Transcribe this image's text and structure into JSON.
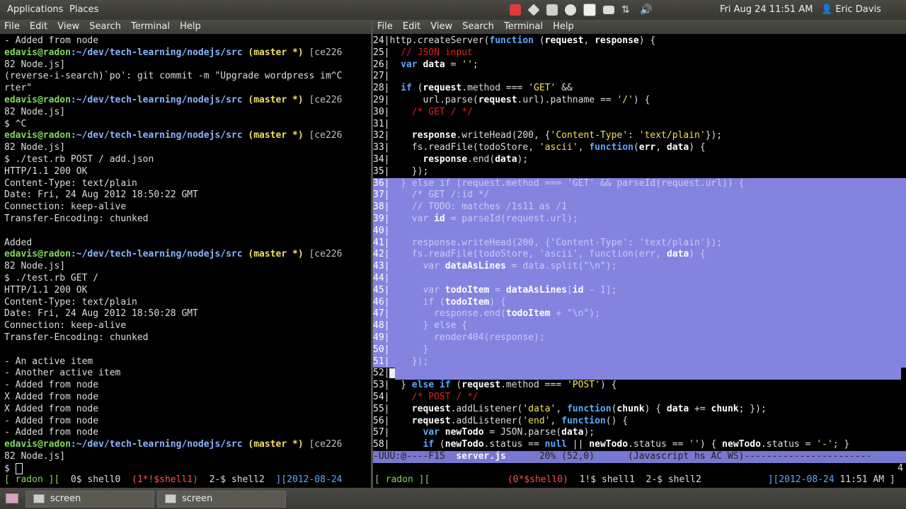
{
  "top_panel": {
    "applications": "Applications",
    "places": "Places",
    "clock": "Fri Aug 24 11:51 AM",
    "user": "Eric Davis",
    "icons": [
      "mail-icon",
      "dropbox-icon",
      "briefcase-icon",
      "chrome-icon",
      "newspaper-icon",
      "envelope-icon",
      "network-arrows-icon",
      "volume-icon"
    ]
  },
  "terminal_menu": [
    "File",
    "Edit",
    "View",
    "Search",
    "Terminal",
    "Help"
  ],
  "left_terminal": {
    "lines": [
      "- Added from node",
      "#P",
      "82 Node.js]",
      "(reverse-i-search)`po': git commit -m \"Upgrade wordpress im^C",
      "rter\"",
      "#P",
      "82 Node.js]",
      "$ ^C",
      "#P",
      "82 Node.js]",
      "$ ./test.rb POST / add.json",
      "HTTP/1.1 200 OK",
      "Content-Type: text/plain",
      "Date: Fri, 24 Aug 2012 18:50:22 GMT",
      "Connection: keep-alive",
      "Transfer-Encoding: chunked",
      "",
      "Added",
      "#P",
      "82 Node.js]",
      "$ ./test.rb GET /",
      "HTTP/1.1 200 OK",
      "Content-Type: text/plain",
      "Date: Fri, 24 Aug 2012 18:50:28 GMT",
      "Connection: keep-alive",
      "Transfer-Encoding: chunked",
      "",
      "- An active item",
      "- Another active item",
      "- Added from node",
      "X Added from node",
      "X Added from node",
      "- Added from node",
      "- Added from node",
      "#P",
      "82 Node.js]",
      "#C"
    ],
    "prompt": {
      "user": "edavis@radon",
      "path": ":~/dev/tech-learning/nodejs/src",
      "branch": " (master *)",
      "hash": " [ce226"
    },
    "current_prompt": "$ ",
    "screen_bar": {
      "host": "[ radon ][",
      "w0": "0$ shell0",
      "w1": "(1*!$shell1)",
      "w2": "2-$ shell2",
      "date": "][2012-08-24"
    }
  },
  "right_terminal": {
    "code": [
      {
        "n": "24",
        "t": "http.createServer(function (request, response) {"
      },
      {
        "n": "25",
        "t": "  // JSON input"
      },
      {
        "n": "26",
        "t": "  var data = '';"
      },
      {
        "n": "27",
        "t": ""
      },
      {
        "n": "28",
        "t": "  if (request.method === 'GET' &&"
      },
      {
        "n": "29",
        "t": "      url.parse(request.url).pathname == '/') {"
      },
      {
        "n": "30",
        "t": "    /* GET / */"
      },
      {
        "n": "31",
        "t": ""
      },
      {
        "n": "32",
        "t": "    response.writeHead(200, {'Content-Type': 'text/plain'});"
      },
      {
        "n": "33",
        "t": "    fs.readFile(todoStore, 'ascii', function(err, data) {"
      },
      {
        "n": "34",
        "t": "      response.end(data);"
      },
      {
        "n": "35",
        "t": "    });"
      },
      {
        "n": "36",
        "t": "  } else if (request.method === 'GET' && parseId(request.url)) {"
      },
      {
        "n": "37",
        "t": "    /* GET /:id */"
      },
      {
        "n": "38",
        "t": "    // TODO: matches /1s11 as /1"
      },
      {
        "n": "39",
        "t": "    var id = parseId(request.url);"
      },
      {
        "n": "40",
        "t": ""
      },
      {
        "n": "41",
        "t": "    response.writeHead(200, {'Content-Type': 'text/plain'});"
      },
      {
        "n": "42",
        "t": "    fs.readFile(todoStore, 'ascii', function(err, data) {"
      },
      {
        "n": "43",
        "t": "      var dataAsLines = data.split(\"\\n\");"
      },
      {
        "n": "44",
        "t": ""
      },
      {
        "n": "45",
        "t": "      var todoItem = dataAsLines[id - 1];"
      },
      {
        "n": "46",
        "t": "      if (todoItem) {"
      },
      {
        "n": "47",
        "t": "        response.end(todoItem + \"\\n\");"
      },
      {
        "n": "48",
        "t": "      } else {"
      },
      {
        "n": "49",
        "t": "        render404(response);"
      },
      {
        "n": "50",
        "t": "      }"
      },
      {
        "n": "51",
        "t": "    });"
      },
      {
        "n": "52",
        "t": ""
      },
      {
        "n": "53",
        "t": "  } else if (request.method === 'POST') {"
      },
      {
        "n": "54",
        "t": "    /* POST / */"
      },
      {
        "n": "55",
        "t": "    request.addListener('data', function(chunk) { data += chunk; });"
      },
      {
        "n": "56",
        "t": "    request.addListener('end', function() {"
      },
      {
        "n": "57",
        "t": "      var newTodo = JSON.parse(data);"
      },
      {
        "n": "58",
        "t": "      if (newTodo.status == null || newTodo.status == '') { newTodo.status = '-'; }"
      }
    ],
    "modeline": {
      "prefix": "-UUU:@----F15  ",
      "file": "server.js",
      "info": "      20% (52,0)      (Javascript hs AC WS)-----------------------"
    },
    "minibuffer": "4",
    "screen_bar": {
      "host": "[ radon ][",
      "w0": "(0*$shell0)",
      "w1": "1!$ shell1",
      "w2": "2-$ shell2",
      "date": "][2012-08-24",
      "time": " 11:51 AM ]"
    }
  },
  "taskbar": {
    "items": [
      "screen",
      "screen"
    ]
  }
}
